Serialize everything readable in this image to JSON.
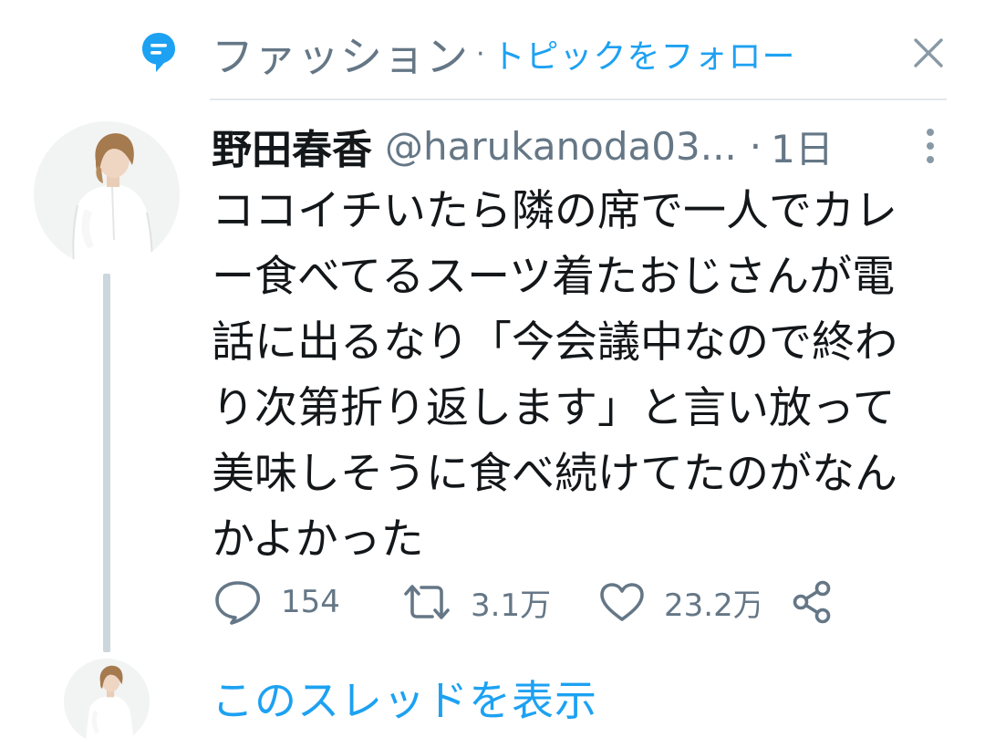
{
  "topic": {
    "icon": "topic-speech-bubble-icon",
    "name": "ファッション",
    "separator": "·",
    "follow_label": "トピックをフォロー",
    "close_icon": "close-icon"
  },
  "tweet": {
    "author_name": "野田春香",
    "handle": "@harukanoda03...",
    "separator": "·",
    "time": "1日",
    "text_lines": [
      "ココイチいたら隣の席で一人でカレ",
      "ー食べてるスーツ着たおじさんが電",
      "話に出るなり「今会議中なので終わ",
      "り次第折り返します」と言い放って",
      "美味しそうに食べ続けてたのがなん",
      "かよかった"
    ],
    "replies": "154",
    "retweets": "3.1万",
    "likes": "23.2万"
  },
  "thread": {
    "show_label": "このスレッドを表示"
  },
  "colors": {
    "accent": "#1da1f2",
    "secondary_text": "#657786",
    "primary_text": "#14171a",
    "thread_line": "#ccd6dd"
  }
}
